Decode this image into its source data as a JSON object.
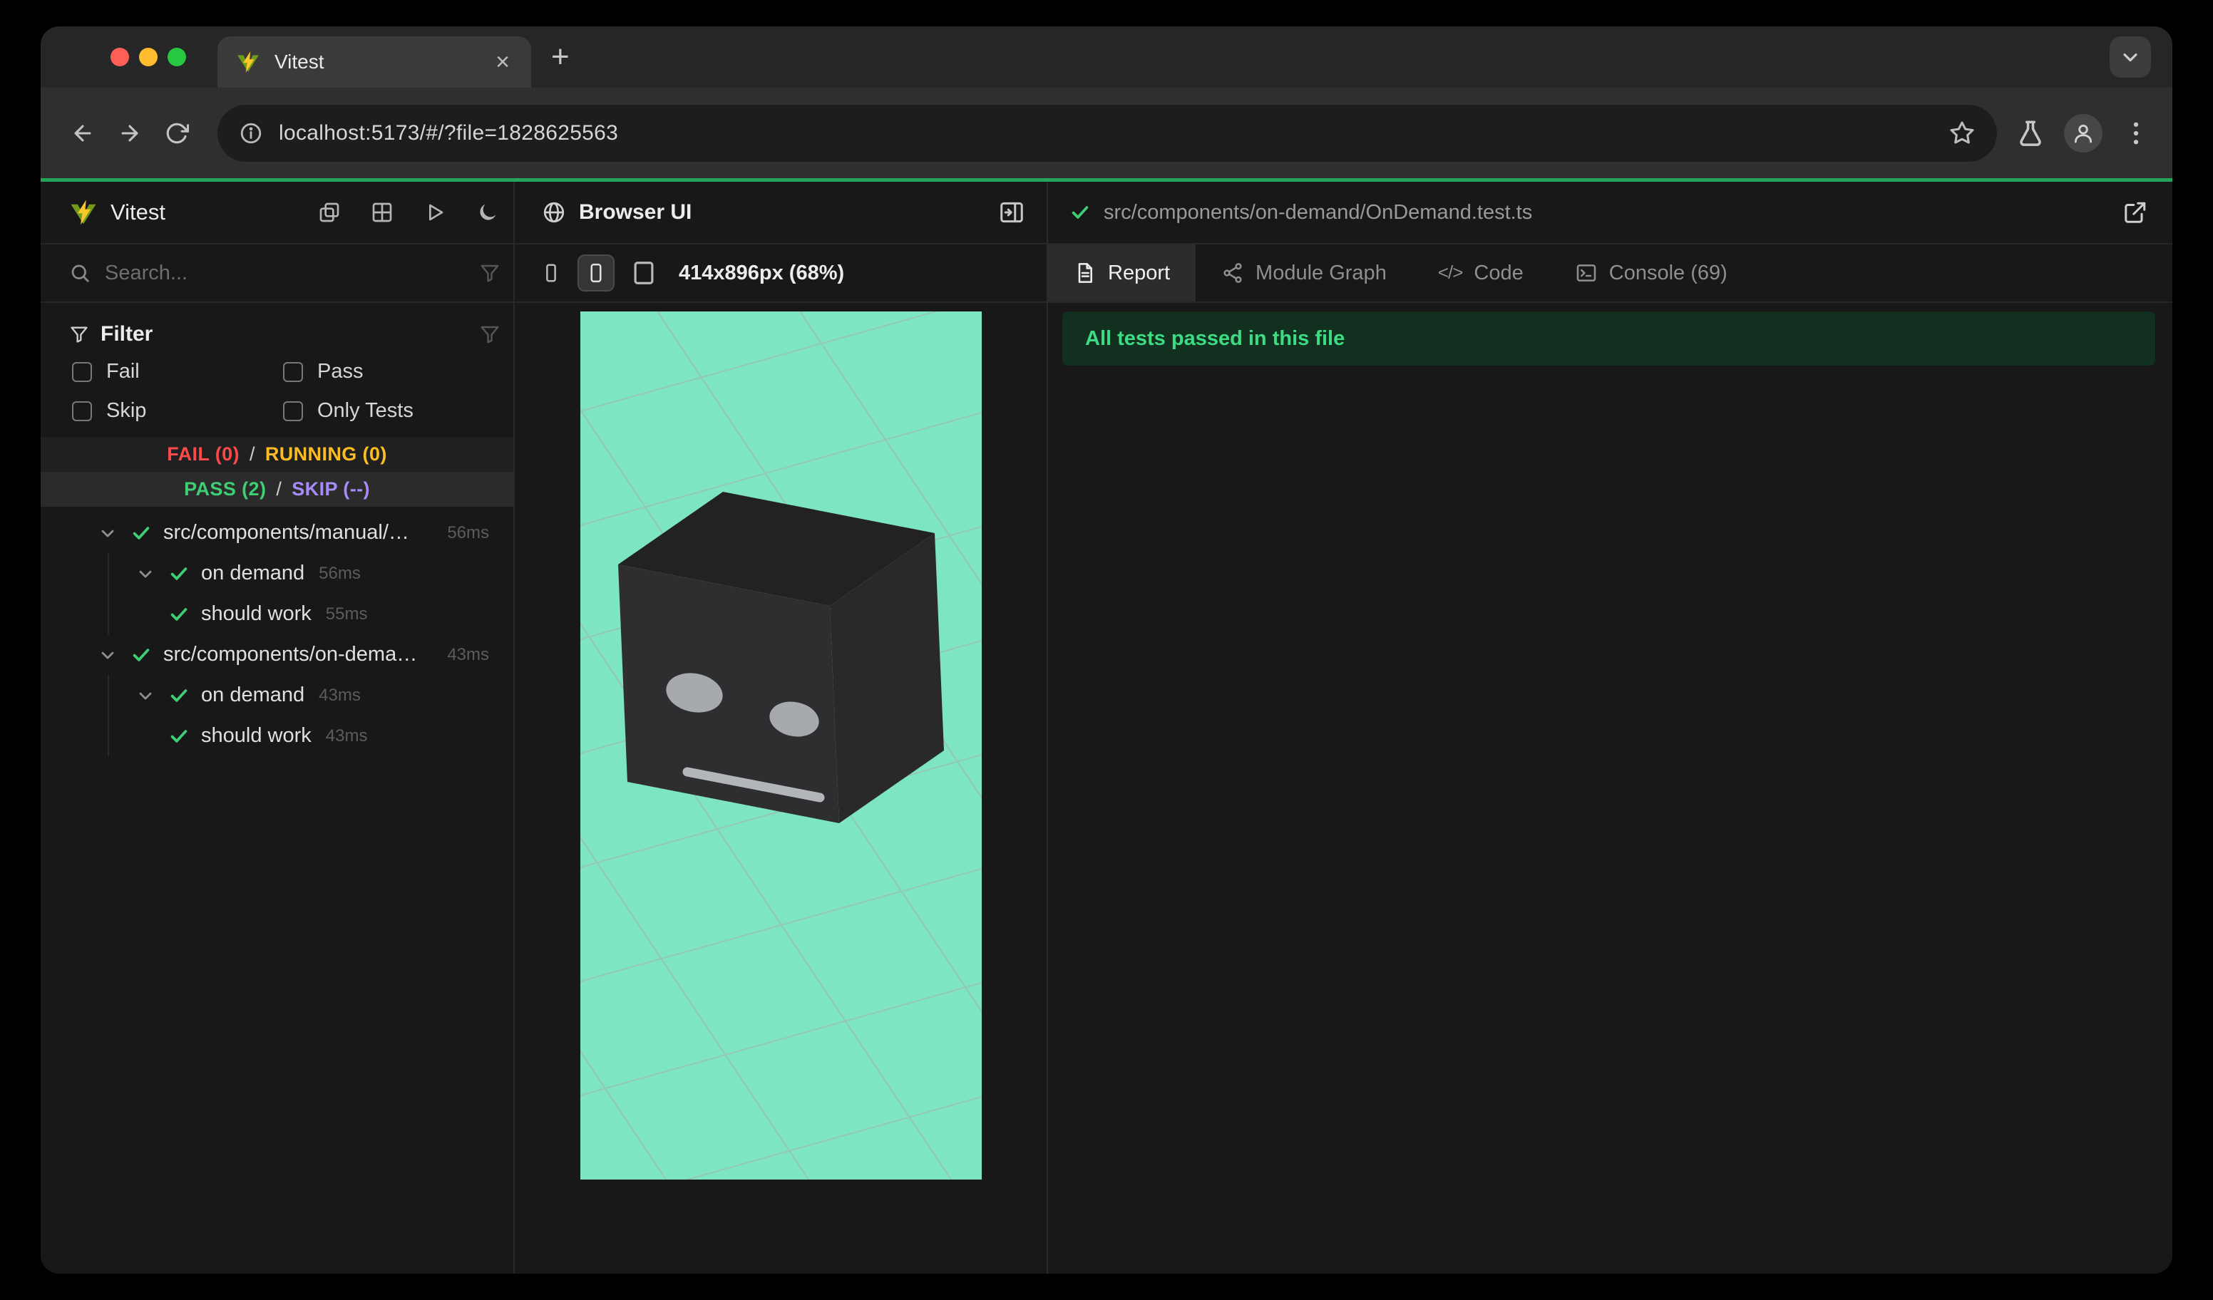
{
  "colors": {
    "accent": "#23a55a",
    "fail": "#fb4a4a",
    "running": "#fbbd23",
    "pass": "#3ecf74",
    "skip": "#a78bfa",
    "teal": "#7de4c4",
    "banner_bg": "#12301f",
    "banner_text": "#3ddc84"
  },
  "icons": {
    "close": "×",
    "new_tab": "+",
    "code": "</>"
  },
  "browser": {
    "tab_title": "Vitest",
    "url": "localhost:5173/#/?file=1828625563"
  },
  "sidebar": {
    "app_title": "Vitest",
    "search_placeholder": "Search...",
    "filter_title": "Filter",
    "checkboxes": [
      "Fail",
      "Pass",
      "Skip",
      "Only Tests"
    ],
    "summary": {
      "fail": "FAIL (0)",
      "running": "RUNNING (0)",
      "pass": "PASS (2)",
      "skip": "SKIP (--)",
      "separator": "/"
    },
    "tree": [
      {
        "label": "src/components/manual/…",
        "duration": "56ms"
      },
      {
        "label": "on demand",
        "duration": "56ms"
      },
      {
        "label": "should work",
        "duration": "55ms"
      },
      {
        "label": "src/components/on-dema…",
        "duration": "43ms"
      },
      {
        "label": "on demand",
        "duration": "43ms"
      },
      {
        "label": "should work",
        "duration": "43ms"
      }
    ]
  },
  "preview": {
    "title": "Browser UI",
    "viewport_label": "414x896px (68%)"
  },
  "report": {
    "file_path": "src/components/on-demand/OnDemand.test.ts",
    "tabs": [
      {
        "label": "Report"
      },
      {
        "label": "Module Graph"
      },
      {
        "label": "Code"
      },
      {
        "label": "Console (69)"
      }
    ],
    "banner": "All tests passed in this file"
  }
}
